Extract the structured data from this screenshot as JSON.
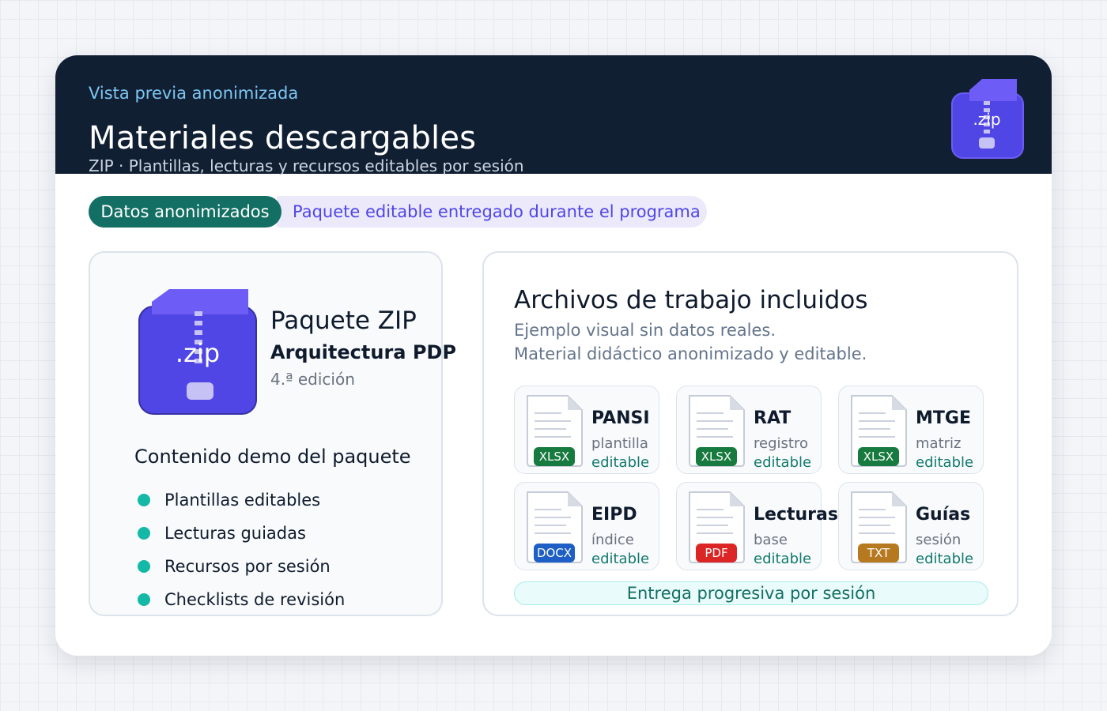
{
  "header": {
    "eyebrow": "Vista previa anonimizada",
    "title": "Materiales descargables",
    "subtitle": "ZIP · Plantillas, lecturas y recursos editables por sesión",
    "zip_label": ".zip"
  },
  "badges": {
    "primary": "Datos anonimizados",
    "secondary": "Paquete editable entregado durante el programa"
  },
  "package": {
    "zip_label": ".zip",
    "title": "Paquete ZIP",
    "subtitle": "Arquitectura PDP",
    "edition": "4.ª edición",
    "contents_title": "Contenido demo del paquete",
    "contents": [
      "Plantillas editables",
      "Lecturas guiadas",
      "Recursos por sesión",
      "Checklists de revisión"
    ]
  },
  "files": {
    "title": "Archivos de trabajo incluidos",
    "desc_line1": "Ejemplo visual sin datos reales.",
    "desc_line2": "Material didáctico anonimizado y editable.",
    "items": [
      {
        "name": "PANSI",
        "type": "XLSX",
        "line1": "plantilla",
        "line2": "editable",
        "color": "#177a3e"
      },
      {
        "name": "RAT",
        "type": "XLSX",
        "line1": "registro",
        "line2": "editable",
        "color": "#177a3e"
      },
      {
        "name": "MTGE",
        "type": "XLSX",
        "line1": "matriz",
        "line2": "editable",
        "color": "#177a3e"
      },
      {
        "name": "EIPD",
        "type": "DOCX",
        "line1": "índice",
        "line2": "editable",
        "color": "#1d5fc4"
      },
      {
        "name": "Lecturas",
        "type": "PDF",
        "line1": "base",
        "line2": "editable",
        "color": "#dc2626"
      },
      {
        "name": "Guías",
        "type": "TXT",
        "line1": "sesión",
        "line2": "editable",
        "color": "#b7791f"
      }
    ],
    "delivery": "Entrega progresiva por sesión"
  },
  "colors": {
    "header_bg": "#111f33",
    "accent_teal": "#136f63",
    "accent_purple": "#4f46e5",
    "zip_purple": "#4f46e5"
  }
}
